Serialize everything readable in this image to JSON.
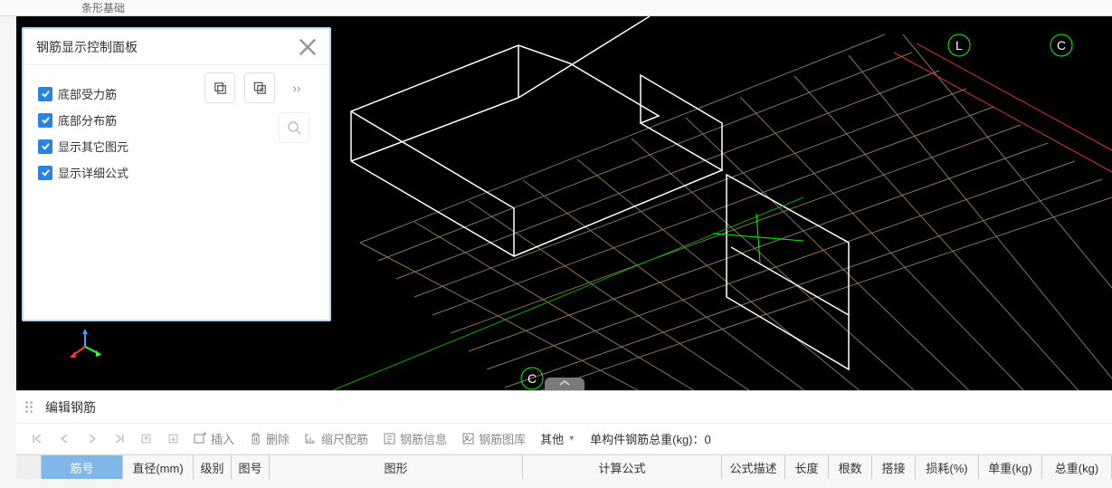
{
  "topbar": {
    "item1": "条形基础",
    "item2": ""
  },
  "panel": {
    "title": "钢筋显示控制面板",
    "checks": [
      "底部受力筋",
      "底部分布筋",
      "显示其它图元",
      "显示详细公式"
    ]
  },
  "scene": {
    "markerC": "C",
    "markerL": "L"
  },
  "dock": {
    "title": "编辑钢筋",
    "tools": {
      "insert": "插入",
      "delete": "删除",
      "scale": "缩尺配筋",
      "info": "钢筋信息",
      "lib": "钢筋图库",
      "other": "其他"
    },
    "summary_label": "单构件钢筋总重(kg)：",
    "summary_value": "0",
    "columns": [
      "筋号",
      "直径(mm)",
      "级别",
      "图号",
      "图形",
      "计算公式",
      "公式描述",
      "长度",
      "根数",
      "搭接",
      "损耗(%)",
      "单重(kg)",
      "总重(kg)"
    ]
  }
}
